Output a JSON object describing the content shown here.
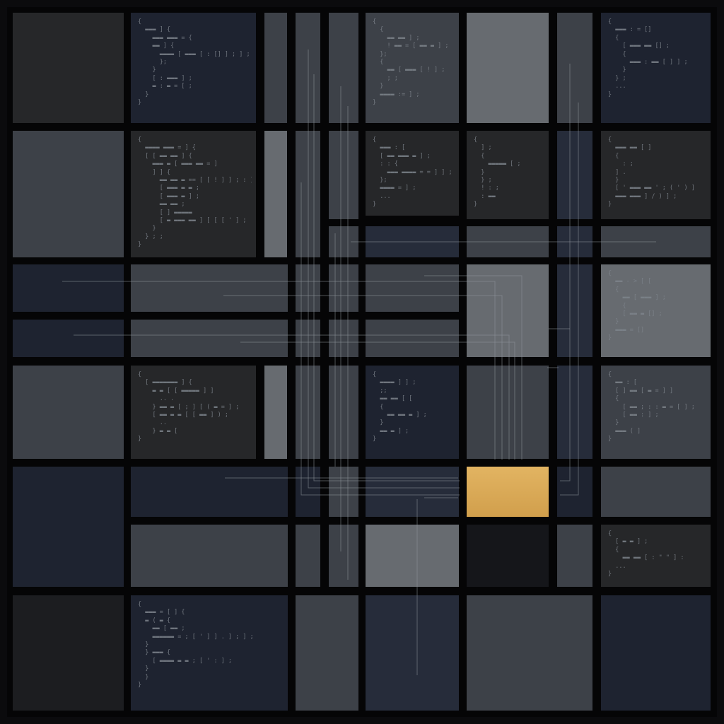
{
  "colors": {
    "frame": "#070708",
    "navy": "#1e2330",
    "charcoal": "#262729",
    "slate": "#3d4148",
    "gray": "#5a5e63",
    "accent": "#dcaa58",
    "code_text": "#7e848c"
  },
  "code_snippets": {
    "s1": "{\n  ▬▬▬ ] {\n    ▬▬▬ ▬▬▬ = {\n    ▬▬ ] {\n      ▬▬▬▬ [ ▬▬▬ [ : [] ] ; ] ;\n      };\n    }\n    [ : ▬▬▬ ] ;\n    ▬ : ▬ = [ ;\n  }\n}",
    "s2": "{\n  {\n    ▬▬ ▬▬ ] ;\n    ! ▬▬ = [ ▬▬ ▬ ] ;\n  };\n  {\n    ▬▬ [ ▬▬▬ [ ! ] ;\n    ; ;\n  }\n  ▬▬▬▬ := ] ;\n}",
    "s3": "{\n  ▬▬▬ : = []\n  {\n    [ ▬▬▬ ▬▬ [] ;\n    {\n      ▬▬▬ : ▬▬ [ ] ] ;\n    }\n  } ;\n  ...\n}",
    "s4": "{\n  ▬▬▬▬ ▬▬▬ = ] {\n  [ [ ▬▬ ▬▬ ] {\n    ▬▬▬ ▬ [ ▬▬▬ ▬▬ = ]\n    ] ] {\n      ▬▬ ▬▬ ▬ == [ [ ! ] ] ; : ]\n      [ ▬▬▬ ▬ ▬ ;\n      [ ▬▬▬ ▬ ] ;\n      ▬▬ ▬▬ ;\n      [ ] ▬▬▬▬▬\n      [ ▬ ▬▬▬ ▬▬ ] [ [ [ ' ] ;\n    }\n  } ; ;\n}",
    "s5": "{\n  ▬▬▬ : [\n  [ ▬▬ ▬▬▬ ▬ ] ;\n  : : {\n    ▬▬▬ ▬▬▬▬ = = ] ] ;\n  };\n  ▬▬▬▬ = ] ;\n  ...\n}",
    "s6": "{\n  ] ;\n  {\n    ▬▬▬▬▬ [ ;\n  }\n  } ;\n  ! : ;\n  : ▬▬\n}",
    "s7": "{\n  ▬▬▬ ▬▬ [ ]\n  {\n    : ;\n  ] .\n  }\n  [ ' ▬▬▬ ▬▬ ' ; ( ' ) ]\n  ▬▬▬ ▬▬▬ ] / ) ] ;\n}",
    "s8": "{\n  ▬▬ - > [ [\n  {\n    ▬▬ [ ▬▬▬ ] ;\n    {\n    [ ▬▬ ▬ [] ;\n  }\n  ▬▬▬ = []\n}",
    "s9": "{\n  [ ▬▬▬▬▬▬▬ ] {\n    ▬ ▬ [ [ ▬▬▬▬▬ ] ]\n      .. .\n    } ▬▬ ▬ [ ; ] [ ( ▬ = ] ;\n    [ ▬▬ ▬ ▬ [ [ ▬▬ ] ) ;\n      ..\n    } ▬ ▬ [\n}",
    "s10": "{\n  ▬▬▬▬ ] ] ;\n  ;;\n  ▬▬ ▬▬ [ [\n  {\n    ▬▬ ▬▬ ▬ ] ;\n  }\n  ▬▬ ▬ ] ;\n}",
    "s11": "{\n  ▬▬ : [\n  [ ] ▬▬ [ ▬ = ] ]\n  {\n    [ ▬▬ ; : : ▬ = [ ] ;\n    [ ▬▬ : ] ;\n  }\n  ▬▬▬ ( ]\n}",
    "s12": "{\n  [ ▬ ▬ ] ;\n  {\n    ▬▬ ▬▬ [ : \" \" ] :\n  ...\n}",
    "s13": "{\n  ▬▬▬ = [ ] {\n  ▬ ( ▬ {\n    ▬▬ [ ▬▬ ;\n    ▬▬▬▬▬▬ = ; [ ' ] ] . ] ; ] ;\n  }\n  } ▬▬▬ {\n    [ ▬▬▬▬ ▬ ▬ ; [ ' : ] ;\n  }\n  }\n}"
  }
}
